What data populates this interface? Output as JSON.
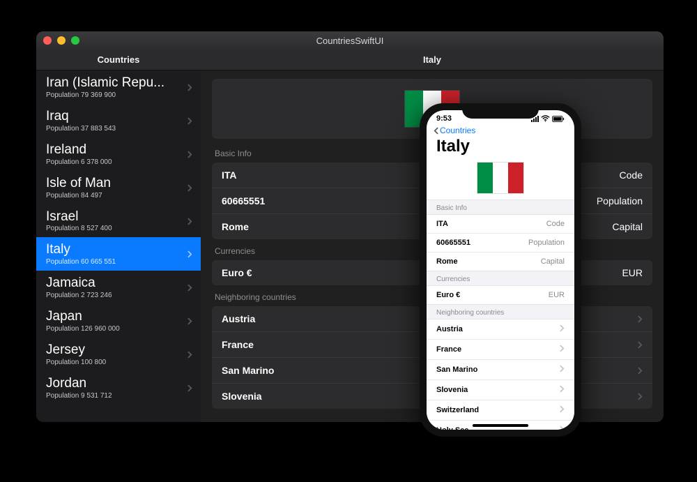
{
  "mac": {
    "window_title": "CountriesSwiftUI",
    "sidebar_header": "Countries",
    "detail_header": "Italy",
    "countries": [
      {
        "name": "Iran (Islamic Repu...",
        "pop": "Population 79 369 900",
        "selected": false
      },
      {
        "name": "Iraq",
        "pop": "Population 37 883 543",
        "selected": false
      },
      {
        "name": "Ireland",
        "pop": "Population 6 378 000",
        "selected": false
      },
      {
        "name": "Isle of Man",
        "pop": "Population 84 497",
        "selected": false
      },
      {
        "name": "Israel",
        "pop": "Population 8 527 400",
        "selected": false
      },
      {
        "name": "Italy",
        "pop": "Population 60 665 551",
        "selected": true
      },
      {
        "name": "Jamaica",
        "pop": "Population 2 723 246",
        "selected": false
      },
      {
        "name": "Japan",
        "pop": "Population 126 960 000",
        "selected": false
      },
      {
        "name": "Jersey",
        "pop": "Population 100 800",
        "selected": false
      },
      {
        "name": "Jordan",
        "pop": "Population 9 531 712",
        "selected": false
      }
    ],
    "sections": {
      "basic_info_label": "Basic Info",
      "basic_info": [
        {
          "left": "ITA",
          "right": "Code"
        },
        {
          "left": "60665551",
          "right": "Population"
        },
        {
          "left": "Rome",
          "right": "Capital"
        }
      ],
      "currencies_label": "Currencies",
      "currencies": [
        {
          "left": "Euro €",
          "right": "EUR"
        }
      ],
      "neighbors_label": "Neighboring countries",
      "neighbors": [
        {
          "left": "Austria"
        },
        {
          "left": "France"
        },
        {
          "left": "San Marino"
        },
        {
          "left": "Slovenia"
        }
      ]
    }
  },
  "ios": {
    "time": "9:53",
    "back_label": "Countries",
    "title": "Italy",
    "basic_info_label": "Basic Info",
    "basic_info": [
      {
        "left": "ITA",
        "right": "Code"
      },
      {
        "left": "60665551",
        "right": "Population"
      },
      {
        "left": "Rome",
        "right": "Capital"
      }
    ],
    "currencies_label": "Currencies",
    "currencies": [
      {
        "left": "Euro €",
        "right": "EUR"
      }
    ],
    "neighbors_label": "Neighboring countries",
    "neighbors": [
      {
        "left": "Austria"
      },
      {
        "left": "France"
      },
      {
        "left": "San Marino"
      },
      {
        "left": "Slovenia"
      },
      {
        "left": "Switzerland"
      },
      {
        "left": "Holy See"
      }
    ]
  }
}
